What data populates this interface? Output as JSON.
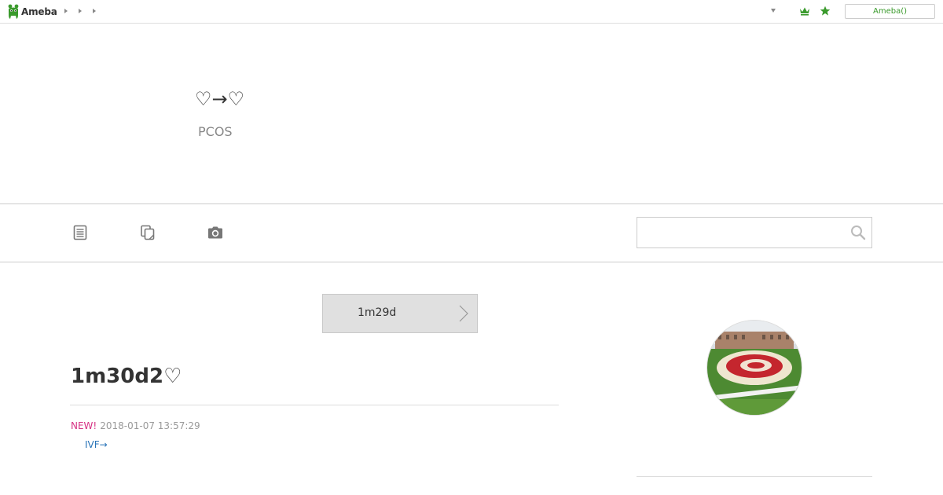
{
  "topbar": {
    "logo_text": "Ameba",
    "account_button": "Ameba()",
    "colors": {
      "brand_green": "#3a9a2c"
    },
    "icons": [
      "ameba-logo-icon",
      "crown-icon",
      "star-icon",
      "dropdown-icon"
    ]
  },
  "blog": {
    "title": "♡→♡",
    "description": "PCOS"
  },
  "nav": {
    "icons": [
      "entries-list-icon",
      "theme-list-icon",
      "camera-icon"
    ],
    "search": {
      "value": "",
      "placeholder": ""
    }
  },
  "pager": {
    "label": "1m29d"
  },
  "article": {
    "title": "1m30d2♡",
    "new_label": "NEW!",
    "date": "2018-01-07 13:57:29",
    "theme_link": "IVF→",
    "colors": {
      "new": "#d63384",
      "link": "#2a74b8"
    }
  },
  "sidebar": {
    "avatar_icon": "profile-avatar"
  }
}
